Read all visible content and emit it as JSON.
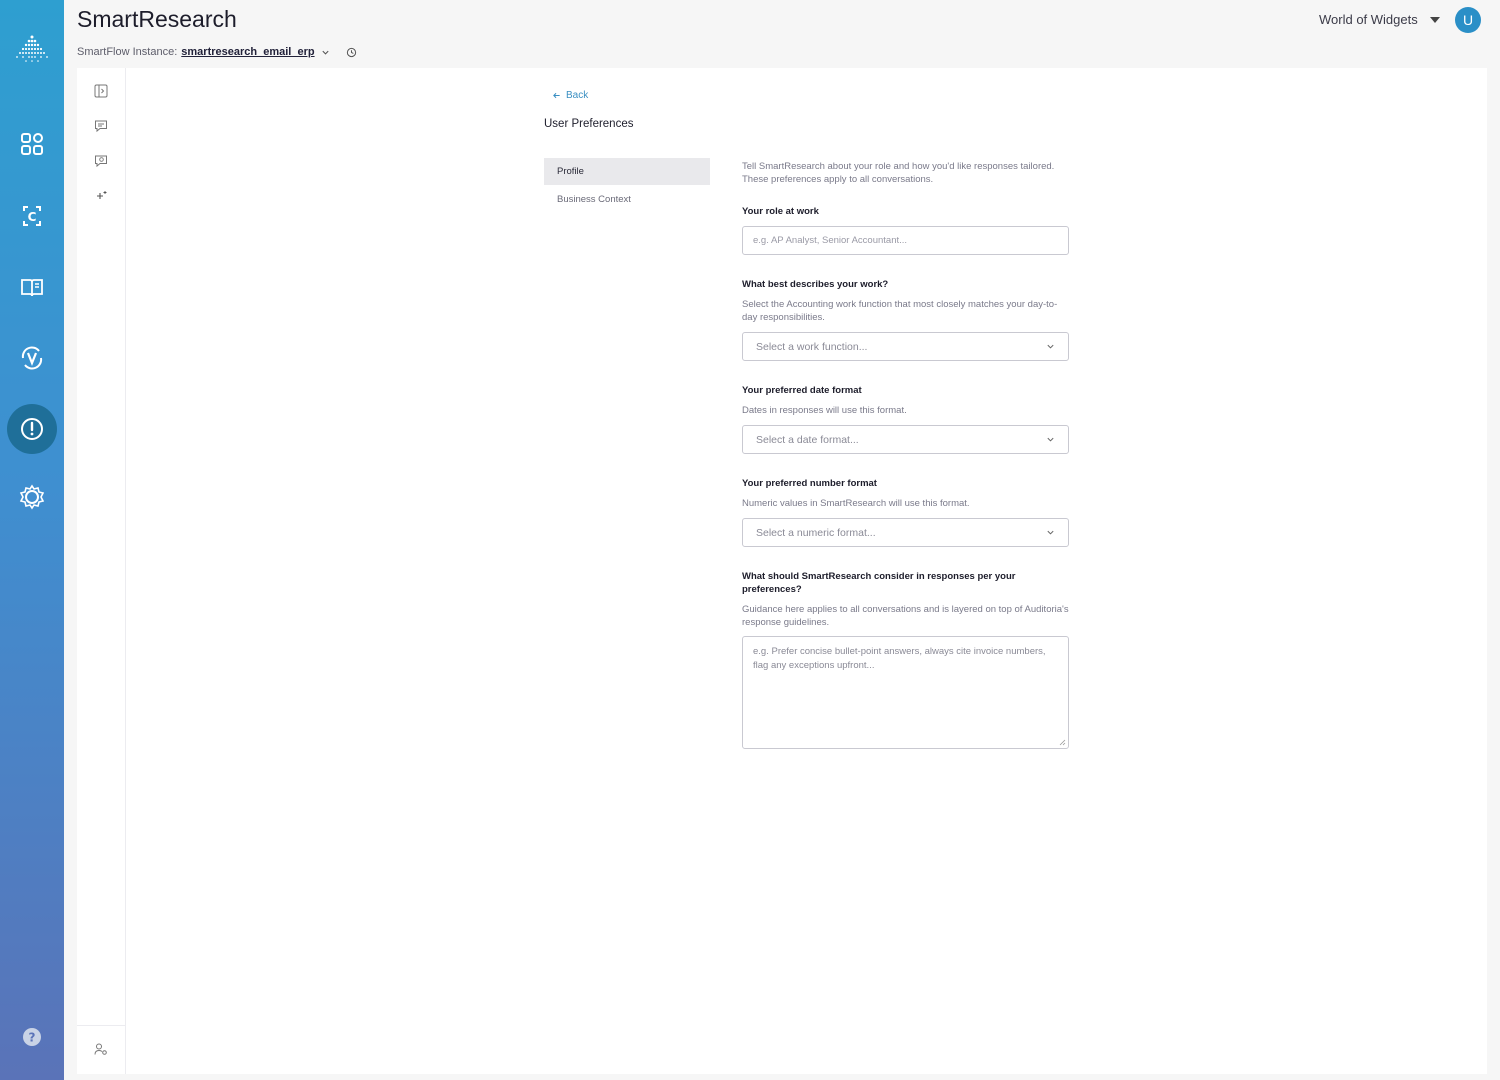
{
  "app": {
    "title": "SmartResearch",
    "instance_label": "SmartFlow Instance:",
    "instance_name": "smartresearch_email_erp",
    "org_name": "World of Widgets",
    "avatar_initial": "U"
  },
  "rail": {
    "items": [
      {
        "icon": "dashboard-icon"
      },
      {
        "icon": "smartflow-c-icon"
      },
      {
        "icon": "book-icon"
      },
      {
        "icon": "verify-v-icon"
      },
      {
        "icon": "alert-circle-icon",
        "active": true
      },
      {
        "icon": "settings-gear-icon"
      }
    ],
    "help_icon": "help-icon",
    "accent": "#1f6f99"
  },
  "toolbar": {
    "items": [
      "panel-toggle-icon",
      "new-chat-icon",
      "search-chats-icon",
      "sparkle-add-icon"
    ],
    "bottom": "user-settings-icon"
  },
  "page": {
    "back_label": "Back",
    "title": "User Preferences",
    "tabs": [
      {
        "label": "Profile",
        "active": true
      },
      {
        "label": "Business Context",
        "active": false
      }
    ]
  },
  "form": {
    "intro": "Tell SmartResearch about your role and how you'd like responses tailored. These preferences apply to all conversations.",
    "role": {
      "label": "Your role at work",
      "placeholder": "e.g. AP Analyst, Senior Accountant..."
    },
    "work_function": {
      "label": "What best describes your work?",
      "hint": "Select the Accounting work function that most closely matches your day-to-day responsibilities.",
      "placeholder": "Select a work function..."
    },
    "date_format": {
      "label": "Your preferred date format",
      "hint": "Dates in responses will use this format.",
      "placeholder": "Select a date format..."
    },
    "number_format": {
      "label": "Your preferred number format",
      "hint": "Numeric values in SmartResearch will use this format.",
      "placeholder": "Select a numeric format..."
    },
    "guidance": {
      "label": "What should SmartResearch consider in responses per your preferences?",
      "hint": "Guidance here applies to all conversations and is layered on top of Auditoria's response guidelines.",
      "placeholder": "e.g. Prefer concise bullet-point answers, always cite invoice numbers, flag any exceptions upfront..."
    }
  }
}
